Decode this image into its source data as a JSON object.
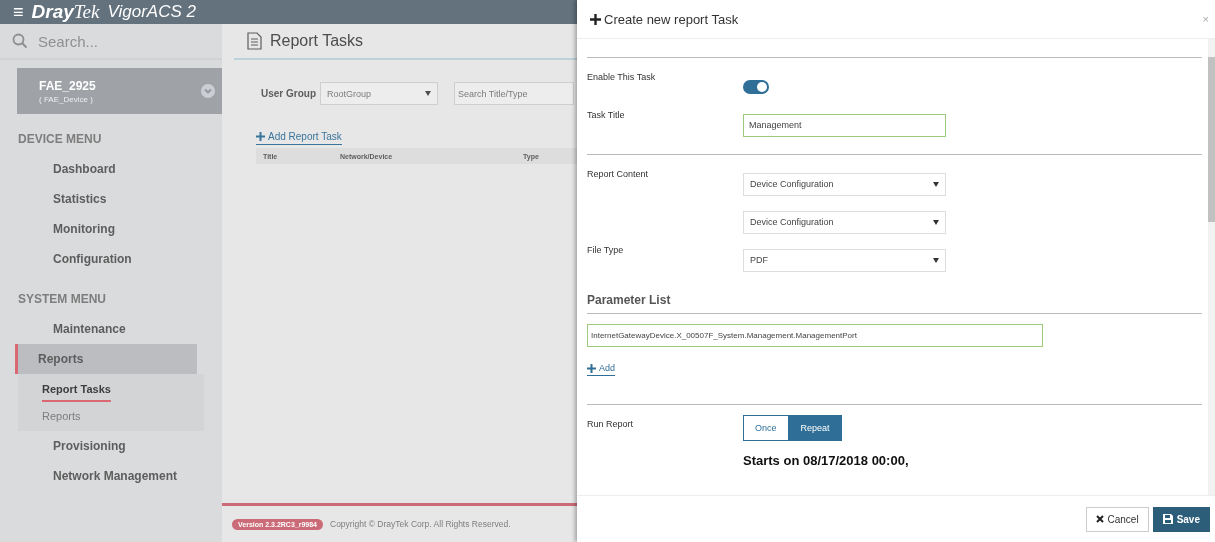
{
  "app": {
    "brand_bold": "Dray",
    "brand_italic": "Tek",
    "product": "VigorACS 2",
    "menu_glyph": "≡"
  },
  "sidebar": {
    "search": {
      "placeholder": "Search..."
    },
    "device": {
      "name": "FAE_2925",
      "sub": "( FAE_Device )"
    },
    "sections": [
      {
        "title": "DEVICE MENU",
        "items": [
          {
            "label": "Dashboard",
            "selected": false
          },
          {
            "label": "Statistics",
            "selected": false
          },
          {
            "label": "Monitoring",
            "selected": false
          },
          {
            "label": "Configuration",
            "selected": false
          }
        ]
      },
      {
        "title": "SYSTEM MENU",
        "items": [
          {
            "label": "Maintenance",
            "selected": false
          },
          {
            "label": "Reports",
            "selected": true,
            "children": [
              {
                "label": "Report Tasks",
                "selected": true
              },
              {
                "label": "Reports",
                "selected": false
              }
            ]
          },
          {
            "label": "Provisioning",
            "selected": false
          },
          {
            "label": "Network Management",
            "selected": false
          }
        ]
      }
    ]
  },
  "page": {
    "title": "Report Tasks",
    "filter_label": "User Group",
    "user_group": "RootGroup",
    "search": {
      "placeholder": "Search Title/Type"
    },
    "add_link": "Add Report Task",
    "table": {
      "columns": [
        "Title",
        "Network/Device",
        "Type"
      ]
    }
  },
  "footer": {
    "version": "Version 2.3.2RC3_r9984",
    "copyright": "Copyright © DrayTek Corp. All Rights Reserved."
  },
  "modal": {
    "title": "Create new report Task",
    "close": "×",
    "enable_label": "Enable This Task",
    "enabled": true,
    "task_title_label": "Task Title",
    "task_title": "Management",
    "report_content_label": "Report Content",
    "report_content": [
      "Device Configuration",
      "Device Configuration"
    ],
    "file_type_label": "File Type",
    "file_type": "PDF",
    "parameter_heading": "Parameter List",
    "parameters": [
      "InternetGatewayDevice.X_00507F_System.Management.ManagementPort"
    ],
    "add_link": "Add",
    "run_report_label": "Run Report",
    "run_modes": [
      {
        "label": "Once",
        "selected": false
      },
      {
        "label": "Repeat",
        "selected": true
      }
    ],
    "schedule": "Starts on 08/17/2018 00:00,",
    "buttons": [
      {
        "label": "Cancel",
        "kind": "cancel"
      },
      {
        "label": "Save",
        "kind": "save"
      }
    ]
  }
}
